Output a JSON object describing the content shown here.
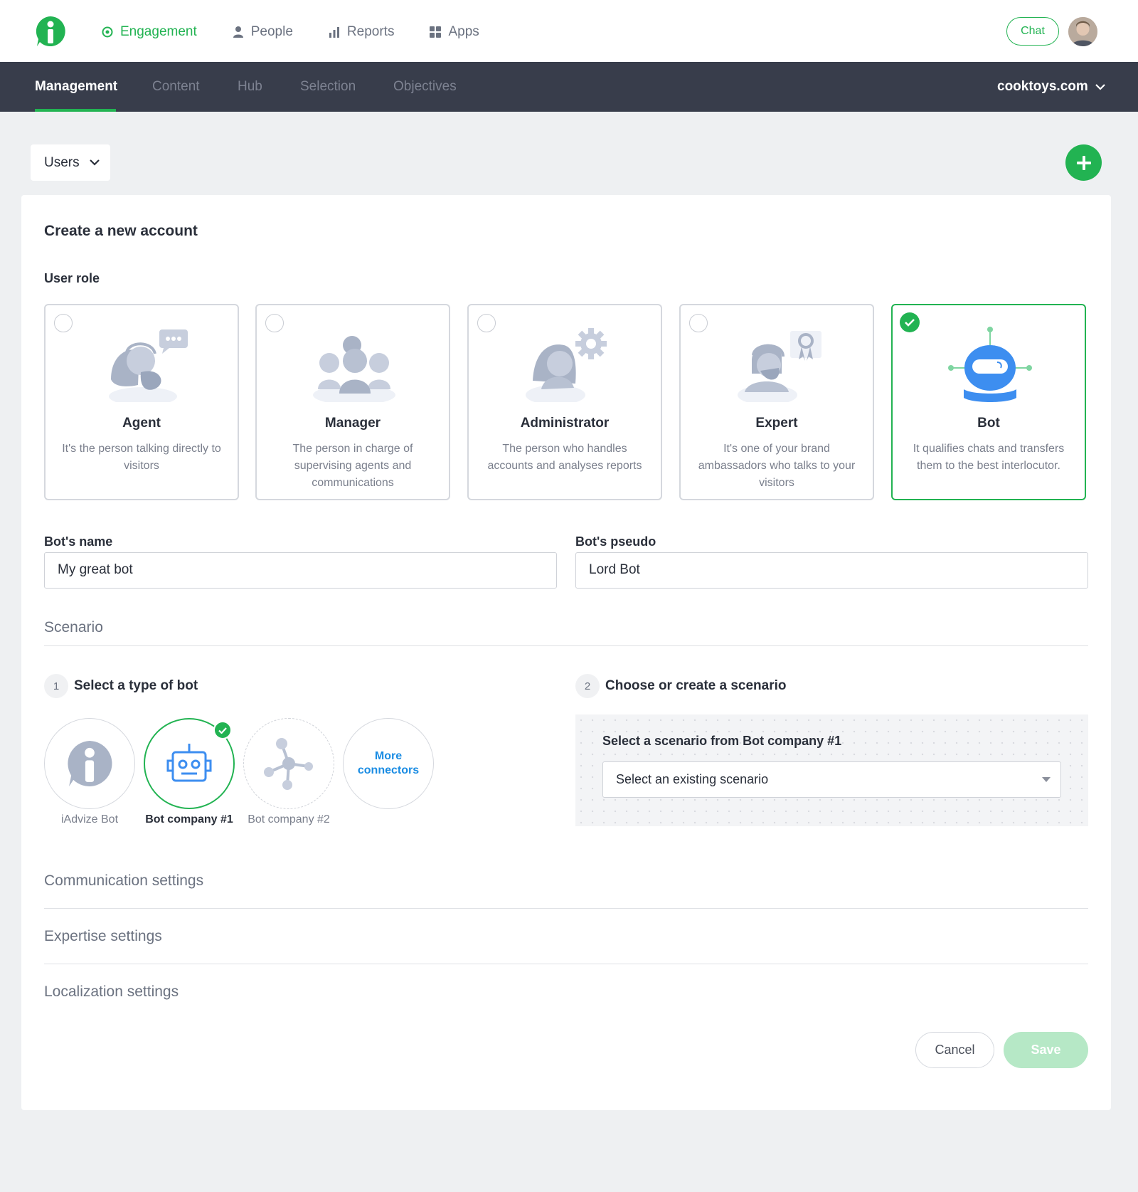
{
  "topnav": {
    "items": [
      {
        "label": "Engagement",
        "icon": "engagement-icon",
        "active": true
      },
      {
        "label": "People",
        "icon": "person-icon"
      },
      {
        "label": "Reports",
        "icon": "bar-chart-icon"
      },
      {
        "label": "Apps",
        "icon": "grid-icon"
      }
    ],
    "chat_label": "Chat"
  },
  "subnav": {
    "tabs": [
      {
        "label": "Management",
        "active": true
      },
      {
        "label": "Content"
      },
      {
        "label": "Hub"
      },
      {
        "label": "Selection"
      },
      {
        "label": "Objectives"
      }
    ],
    "domain": "cooktoys.com"
  },
  "toolbar": {
    "users_label": "Users"
  },
  "form": {
    "title": "Create a new account",
    "role_label": "User role",
    "roles": [
      {
        "name": "Agent",
        "desc": "It's the person talking directly to visitors",
        "selected": false
      },
      {
        "name": "Manager",
        "desc": "The person in charge of supervising agents and communications",
        "selected": false
      },
      {
        "name": "Administrator",
        "desc": "The person who handles accounts and analyses reports",
        "selected": false
      },
      {
        "name": "Expert",
        "desc": "It's one of your brand ambassadors who talks to your visitors",
        "selected": false
      },
      {
        "name": "Bot",
        "desc": "It qualifies chats and transfers them to the best interlocutor.",
        "selected": true
      }
    ],
    "bot_name_label": "Bot's name",
    "bot_name_value": "My great bot",
    "bot_pseudo_label": "Bot's pseudo",
    "bot_pseudo_value": "Lord Bot",
    "scenario_heading": "Scenario",
    "step1": {
      "num": "1",
      "label": "Select a type of bot"
    },
    "step2": {
      "num": "2",
      "label": "Choose or create a scenario"
    },
    "bot_types": [
      {
        "label": "iAdvize Bot"
      },
      {
        "label": "Bot company #1",
        "selected": true
      },
      {
        "label": "Bot company #2"
      },
      {
        "label_line1": "More",
        "label_line2": "connectors"
      }
    ],
    "scenario_select_label": "Select a scenario from Bot company #1",
    "scenario_select_value": "Select an existing scenario",
    "sections": [
      "Communication settings",
      "Expertise settings",
      "Localization settings"
    ],
    "cancel_label": "Cancel",
    "save_label": "Save"
  },
  "colors": {
    "accent": "#22b352",
    "subnav_bg": "#383d4b",
    "link": "#1a8ce3",
    "bot_blue": "#3d8ef0"
  }
}
